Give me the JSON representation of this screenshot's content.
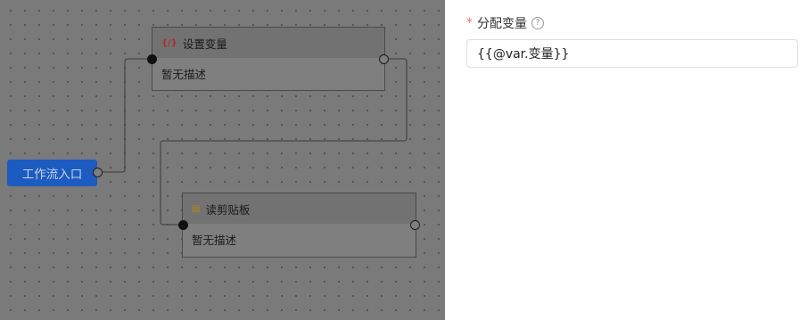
{
  "canvas": {
    "entry_node": {
      "label": "工作流入口"
    },
    "nodes": [
      {
        "title": "设置变量",
        "icon_text": "{/}",
        "icon": "variable-code-icon",
        "icon_color": "#b02a2a",
        "desc": "暂无描述"
      },
      {
        "title": "读剪贴板",
        "icon_text": "▤",
        "icon": "clipboard-icon",
        "icon_color": "#b8860b",
        "desc": "暂无描述"
      }
    ]
  },
  "panel": {
    "required_mark": "*",
    "field_label": "分配变量",
    "help_icon": "question-circle-icon",
    "help_glyph": "?",
    "field_value": "{{@var.变量}}"
  },
  "colors": {
    "entry_bg": "#1c5bc0",
    "required": "#f56c6c",
    "overlay": "#7a7a7a"
  }
}
